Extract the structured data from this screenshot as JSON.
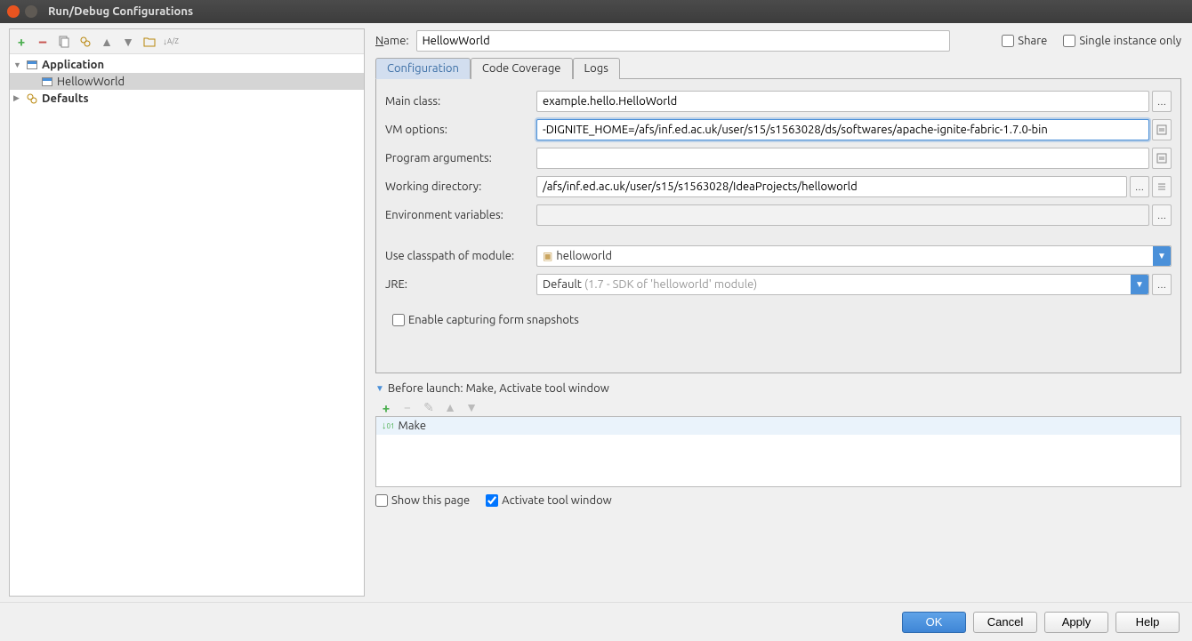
{
  "window": {
    "title": "Run/Debug Configurations"
  },
  "sidebar": {
    "items": [
      {
        "label": "Application",
        "bold": true,
        "expanded": true
      },
      {
        "label": "HellowWorld",
        "bold": false
      },
      {
        "label": "Defaults",
        "bold": true,
        "expanded": false
      }
    ]
  },
  "name": {
    "label": "Name:",
    "value": "HellowWorld"
  },
  "share": {
    "label": "Share",
    "checked": false
  },
  "single_instance": {
    "label": "Single instance only",
    "checked": false
  },
  "tabs": [
    {
      "label": "Configuration",
      "active": true
    },
    {
      "label": "Code Coverage",
      "active": false
    },
    {
      "label": "Logs",
      "active": false
    }
  ],
  "form": {
    "main_class": {
      "label": "Main class:",
      "value": "example.hello.HelloWorld"
    },
    "vm_options": {
      "label": "VM options:",
      "value": "-DIGNITE_HOME=/afs/inf.ed.ac.uk/user/s15/s1563028/ds/softwares/apache-ignite-fabric-1.7.0-bin"
    },
    "program_args": {
      "label": "Program arguments:",
      "value": ""
    },
    "working_dir": {
      "label": "Working directory:",
      "value": "/afs/inf.ed.ac.uk/user/s15/s1563028/IdeaProjects/helloworld"
    },
    "env_vars": {
      "label": "Environment variables:",
      "value": ""
    },
    "classpath": {
      "label": "Use classpath of module:",
      "value": "helloworld"
    },
    "jre": {
      "label": "JRE:",
      "prefix": "Default",
      "hint": "(1.7 - SDK of 'helloworld' module)"
    },
    "snapshots": {
      "label": "Enable capturing form snapshots",
      "checked": false
    }
  },
  "before_launch": {
    "header": "Before launch: Make, Activate tool window",
    "items": [
      {
        "label": "Make"
      }
    ],
    "show_this_page": {
      "label": "Show this page",
      "checked": false
    },
    "activate_tool": {
      "label": "Activate tool window",
      "checked": true
    }
  },
  "footer": {
    "ok": "OK",
    "cancel": "Cancel",
    "apply": "Apply",
    "help": "Help"
  }
}
